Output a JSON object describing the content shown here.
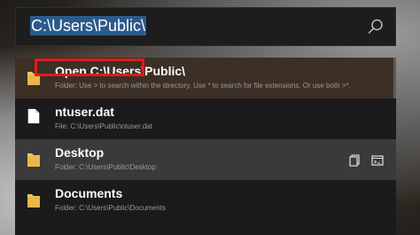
{
  "search": {
    "query": "C:\\Users\\Public\\"
  },
  "results": [
    {
      "title": "Open C:\\Users\\Public\\",
      "subtitle": "Folder: Use > to search within the directory. Use * to search for file extensions. Or use both >*."
    },
    {
      "title": "ntuser.dat",
      "subtitle": "File: C:\\Users\\Public\\ntuser.dat"
    },
    {
      "title": "Desktop",
      "subtitle": "Folder: C:\\Users\\Public\\Desktop"
    },
    {
      "title": "Documents",
      "subtitle": "Folder: C:\\Users\\Public\\Documents"
    }
  ],
  "colors": {
    "selection": "#2c5a8c",
    "highlight_box": "#e01b1b",
    "folder": "#f2c55c"
  },
  "icons": [
    "search-icon",
    "folder-icon",
    "file-icon",
    "copy-path-icon",
    "terminal-icon"
  ]
}
